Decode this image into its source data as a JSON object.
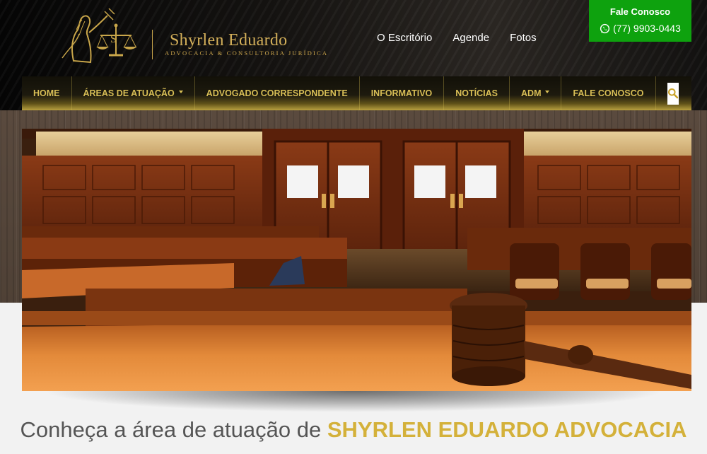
{
  "brand": {
    "name": "Shyrlen Eduardo",
    "tagline": "ADVOCACIA & CONSULTORIA JURÍDICA"
  },
  "top_links": [
    {
      "label": "O Escritório"
    },
    {
      "label": "Agende"
    },
    {
      "label": "Fotos"
    }
  ],
  "contact": {
    "title": "Fale Conosco",
    "phone": "(77) 9903-0443",
    "icon": "whatsapp-icon",
    "color": "#0ea20e"
  },
  "nav": {
    "items": [
      {
        "label": "HOME"
      },
      {
        "label": "ÁREAS DE ATUAÇÃO"
      },
      {
        "label": "ADVOGADO CORRESPONDENTE"
      },
      {
        "label": "INFORMATIVO"
      },
      {
        "label": "NOTÍCIAS"
      },
      {
        "label": "ADM"
      },
      {
        "label": "FALE CONOSCO"
      }
    ],
    "search_icon": "search-icon",
    "text_color": "#d9bf56"
  },
  "headline": {
    "prefix": "Conheça a área de atuação de ",
    "highlight": "SHYRLEN EDUARDO ADVOCACIA",
    "highlight_color": "#d4b13a"
  }
}
